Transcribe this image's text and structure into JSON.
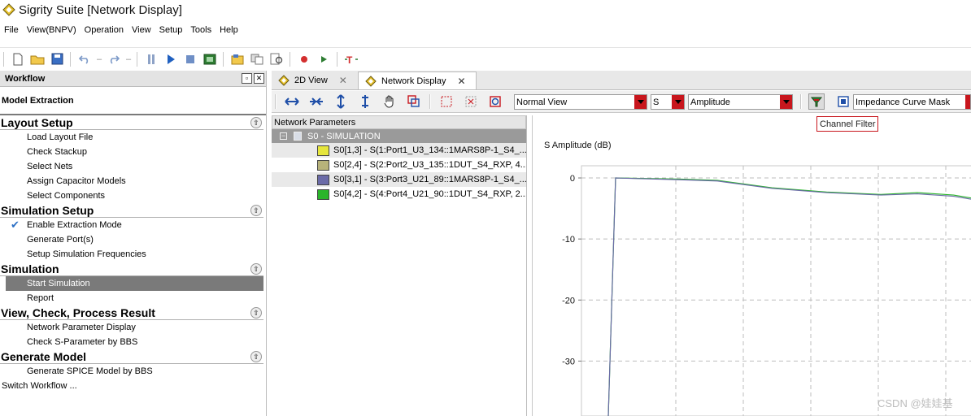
{
  "window": {
    "title": "Sigrity Suite [Network Display]"
  },
  "menu": [
    "File",
    "View(BNPV)",
    "Operation",
    "View",
    "Setup",
    "Tools",
    "Help"
  ],
  "toolbar_icons": [
    "new-file-icon",
    "open-folder-icon",
    "save-icon",
    "undo-icon",
    "redo-icon",
    "pause-icon",
    "play-icon",
    "stop-icon",
    "board-icon",
    "open-project-icon",
    "copy-icon",
    "report-icon",
    "record-icon",
    "run-icon",
    "text-tool-icon"
  ],
  "workflow": {
    "title": "Workflow",
    "mode": "Model Extraction",
    "sections": [
      {
        "title": "Layout Setup",
        "steps": [
          {
            "label": "Load Layout File"
          },
          {
            "label": "Check Stackup"
          },
          {
            "label": "Select Nets"
          },
          {
            "label": "Assign Capacitor Models"
          },
          {
            "label": "Select Components"
          }
        ]
      },
      {
        "title": "Simulation Setup",
        "steps": [
          {
            "label": "Enable Extraction Mode",
            "checked": true
          },
          {
            "label": "Generate Port(s)"
          },
          {
            "label": "Setup Simulation Frequencies"
          }
        ]
      },
      {
        "title": "Simulation",
        "steps": [
          {
            "label": "Start Simulation",
            "selected": true
          },
          {
            "label": "Report"
          }
        ]
      },
      {
        "title": "View, Check, Process Result",
        "steps": [
          {
            "label": "Network Parameter Display"
          },
          {
            "label": "Check S-Parameter by BBS"
          }
        ]
      },
      {
        "title": "Generate Model",
        "steps": [
          {
            "label": "Generate SPICE Model by BBS"
          }
        ]
      }
    ],
    "switch_label": "Switch Workflow ..."
  },
  "tabs": [
    {
      "label": "2D View",
      "active": false
    },
    {
      "label": "Network Display",
      "active": true
    }
  ],
  "viewbar": {
    "view_mode": "Normal View",
    "param": "S",
    "quantity": "Amplitude",
    "mask": "Impedance Curve Mask",
    "tooltip": "Channel Filter"
  },
  "network": {
    "header": "Network Parameters",
    "root": "S0 - SIMULATION",
    "items": [
      {
        "label": "S0[1,3] - S(1:Port1_U3_134::1MARS8P-1_S4_...",
        "color": "#e6e63c"
      },
      {
        "label": "S0[2,4] - S(2:Port2_U3_135::1DUT_S4_RXP, 4...",
        "color": "#b7b27a"
      },
      {
        "label": "S0[3,1] - S(3:Port3_U21_89::1MARS8P-1_S4_...",
        "color": "#6b6ba8"
      },
      {
        "label": "S0[4,2] - S(4:Port4_U21_90::1DUT_S4_RXP, 2...",
        "color": "#2bb52b"
      }
    ]
  },
  "chart_data": {
    "type": "line",
    "title": "",
    "ylabel": "S Amplitude (dB)",
    "yticks": [
      "0",
      "-10",
      "-20",
      "-30"
    ],
    "ylim": [
      -39,
      2
    ],
    "grid": true,
    "series": [
      {
        "color": "#2bb52b",
        "x": [
          0,
          0.02,
          0.2,
          0.3,
          0.45,
          0.6,
          0.75,
          0.85,
          0.95,
          1.0
        ],
        "y": [
          -39,
          0,
          -0.2,
          -0.4,
          -1.6,
          -2.3,
          -2.7,
          -2.4,
          -2.8,
          -3.3
        ]
      },
      {
        "color": "#6b6ba8",
        "x": [
          0,
          0.02,
          0.2,
          0.3,
          0.45,
          0.6,
          0.75,
          0.85,
          0.95,
          1.0
        ],
        "y": [
          -39,
          0,
          -0.3,
          -0.5,
          -1.7,
          -2.4,
          -2.8,
          -2.6,
          -3.0,
          -3.5
        ]
      }
    ]
  },
  "watermark": "CSDN @娃娃基"
}
